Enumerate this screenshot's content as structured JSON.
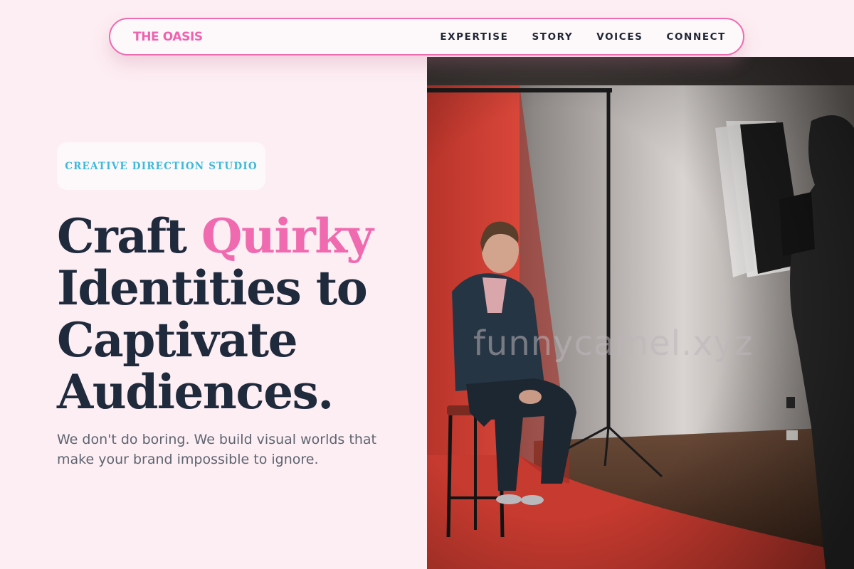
{
  "nav": {
    "logo": "THE OASIS",
    "links": [
      "EXPERTISE",
      "STORY",
      "VOICES",
      "CONNECT"
    ]
  },
  "hero": {
    "badge": "CREATIVE DIRECTION STUDIO",
    "headline": {
      "word1": "Craft",
      "accent": "Quirky",
      "line2": "Identities to",
      "line3": "Captivate",
      "line4": "Audiences."
    },
    "subtitle": "We don't do boring. We build visual worlds that make your brand impossible to ignore."
  },
  "photo": {
    "watermark": "funnycamel.xyz"
  },
  "colors": {
    "background": "#fdeef3",
    "accent_pink": "#f06ab0",
    "badge_text": "#3cb9dc",
    "heading": "#1f2a3c"
  }
}
